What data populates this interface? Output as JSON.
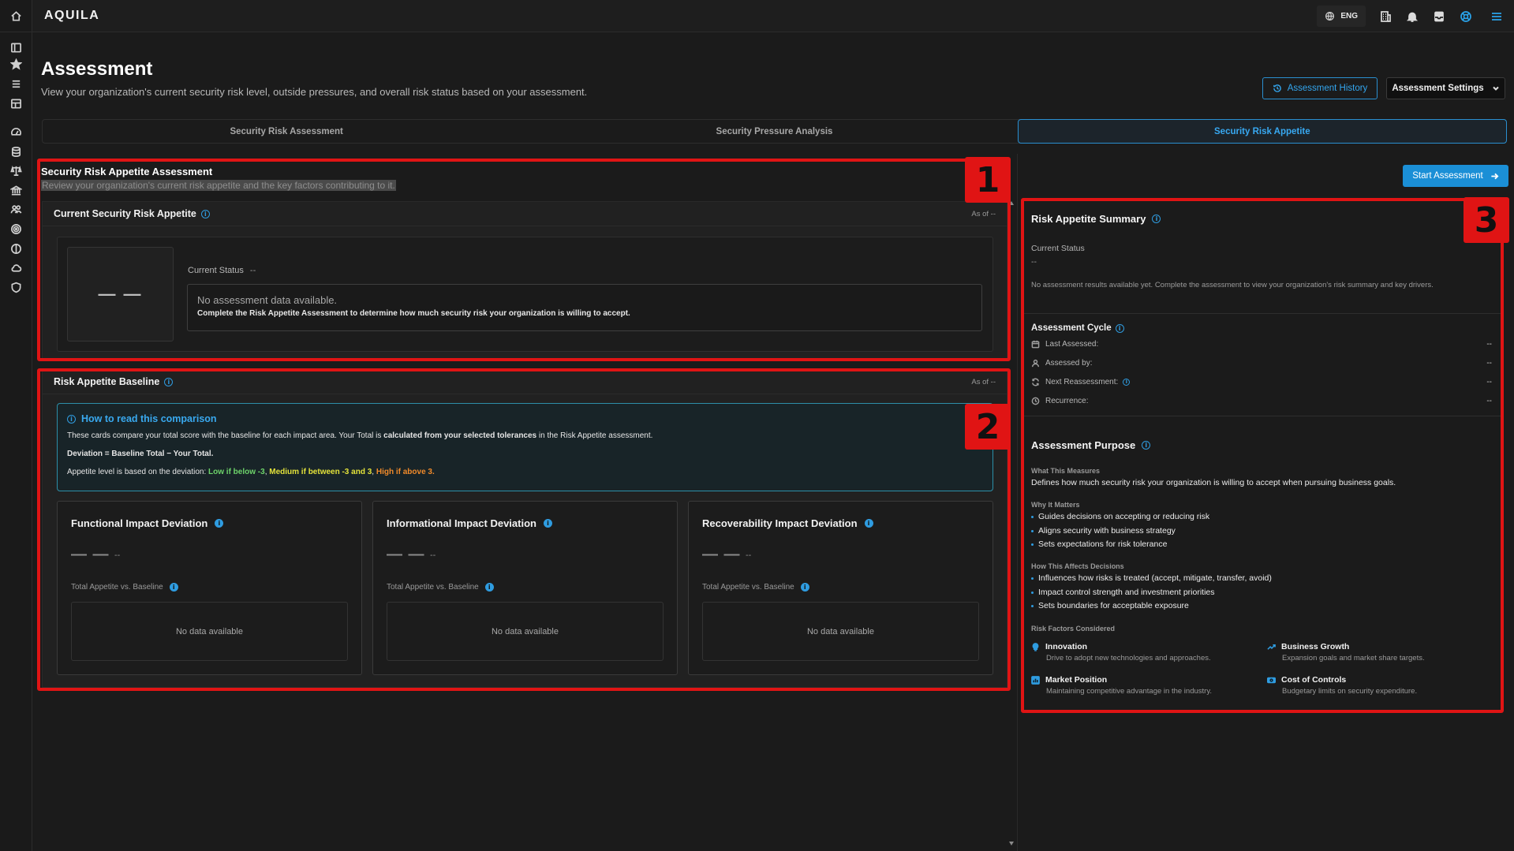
{
  "app": {
    "logo": "AQUILA"
  },
  "topbar": {
    "language": "ENG"
  },
  "page": {
    "title": "Assessment",
    "subtitle": "View your organization's current security risk level, outside pressures, and overall risk status based on your assessment.",
    "history_button": "Assessment History",
    "settings_button": "Assessment Settings"
  },
  "tabs": [
    {
      "label": "Security Risk Assessment",
      "active": false
    },
    {
      "label": "Security Pressure Analysis",
      "active": false
    },
    {
      "label": "Security Risk Appetite",
      "active": true
    }
  ],
  "appetite": {
    "title": "Security Risk Appetite Assessment",
    "subtitle": "Review your organization's current risk appetite and the key factors contributing to it.",
    "current_card": {
      "title": "Current Security Risk Appetite",
      "as_of": "As of --",
      "status_box_value": "— —",
      "status_label": "Current Status",
      "status_value": "--",
      "no_data_title": "No assessment data available.",
      "no_data_body": "Complete the Risk Appetite Assessment to determine how much security risk your organization is willing to accept."
    }
  },
  "baseline": {
    "title": "Risk Appetite Baseline",
    "as_of": "As of --",
    "howto": {
      "title": "How to read this comparison",
      "line1_a": "These cards compare your total score with the baseline for each impact area. Your Total is ",
      "line1_b": "calculated from your selected tolerances",
      "line1_c": " in the Risk Appetite assessment.",
      "deviation": "Deviation = Baseline Total − Your Total.",
      "level_prefix": "Appetite level is based on the deviation: ",
      "low": "Low if below -3",
      "sep": ", ",
      "medium": "Medium if between -3 and 3",
      "high": "High if above 3."
    },
    "cards": [
      {
        "title": "Functional Impact Deviation",
        "value": "— —",
        "sub_value": "--",
        "compare_label": "Total Appetite vs. Baseline",
        "empty": "No data available"
      },
      {
        "title": "Informational Impact Deviation",
        "value": "— —",
        "sub_value": "--",
        "compare_label": "Total Appetite vs. Baseline",
        "empty": "No data available"
      },
      {
        "title": "Recoverability Impact Deviation",
        "value": "— —",
        "sub_value": "--",
        "compare_label": "Total Appetite vs. Baseline",
        "empty": "No data available"
      }
    ]
  },
  "summary": {
    "start_button": "Start Assessment",
    "title": "Risk Appetite Summary",
    "status_label": "Current Status",
    "status_value": "--",
    "note": "No assessment results available yet. Complete the assessment to view your organization's risk summary and key drivers.",
    "cycle_title": "Assessment Cycle",
    "cycle": [
      {
        "label": "Last Assessed:",
        "value": "--"
      },
      {
        "label": "Assessed by:",
        "value": "--"
      },
      {
        "label": "Next Reassessment:",
        "value": "--"
      },
      {
        "label": "Recurrence:",
        "value": "--"
      }
    ],
    "purpose_title": "Assessment Purpose",
    "what_label": "What This Measures",
    "what_text": "Defines how much security risk your organization is willing to accept when pursuing business goals.",
    "why_label": "Why It Matters",
    "why_items": [
      "Guides decisions on accepting or reducing risk",
      "Aligns security with business strategy",
      "Sets expectations for risk tolerance"
    ],
    "how_label": "How This Affects Decisions",
    "how_items": [
      "Influences how risks is treated (accept, mitigate, transfer, avoid)",
      "Impact control strength and investment priorities",
      "Sets boundaries for acceptable exposure"
    ],
    "factors_label": "Risk Factors Considered",
    "factors": [
      {
        "name": "Innovation",
        "desc": "Drive to adopt new technologies and approaches."
      },
      {
        "name": "Business Growth",
        "desc": "Expansion goals and market share targets."
      },
      {
        "name": "Market Position",
        "desc": "Maintaining competitive advantage in the industry."
      },
      {
        "name": "Cost of Controls",
        "desc": "Budgetary limits on security expenditure."
      }
    ]
  },
  "annotations": {
    "one": "1",
    "two": "2",
    "three": "3",
    "color": "#e01414"
  },
  "colors": {
    "accent": "#1b8fd6",
    "low": "#6dd36a",
    "medium": "#e3e23a",
    "high": "#f08a2a"
  }
}
